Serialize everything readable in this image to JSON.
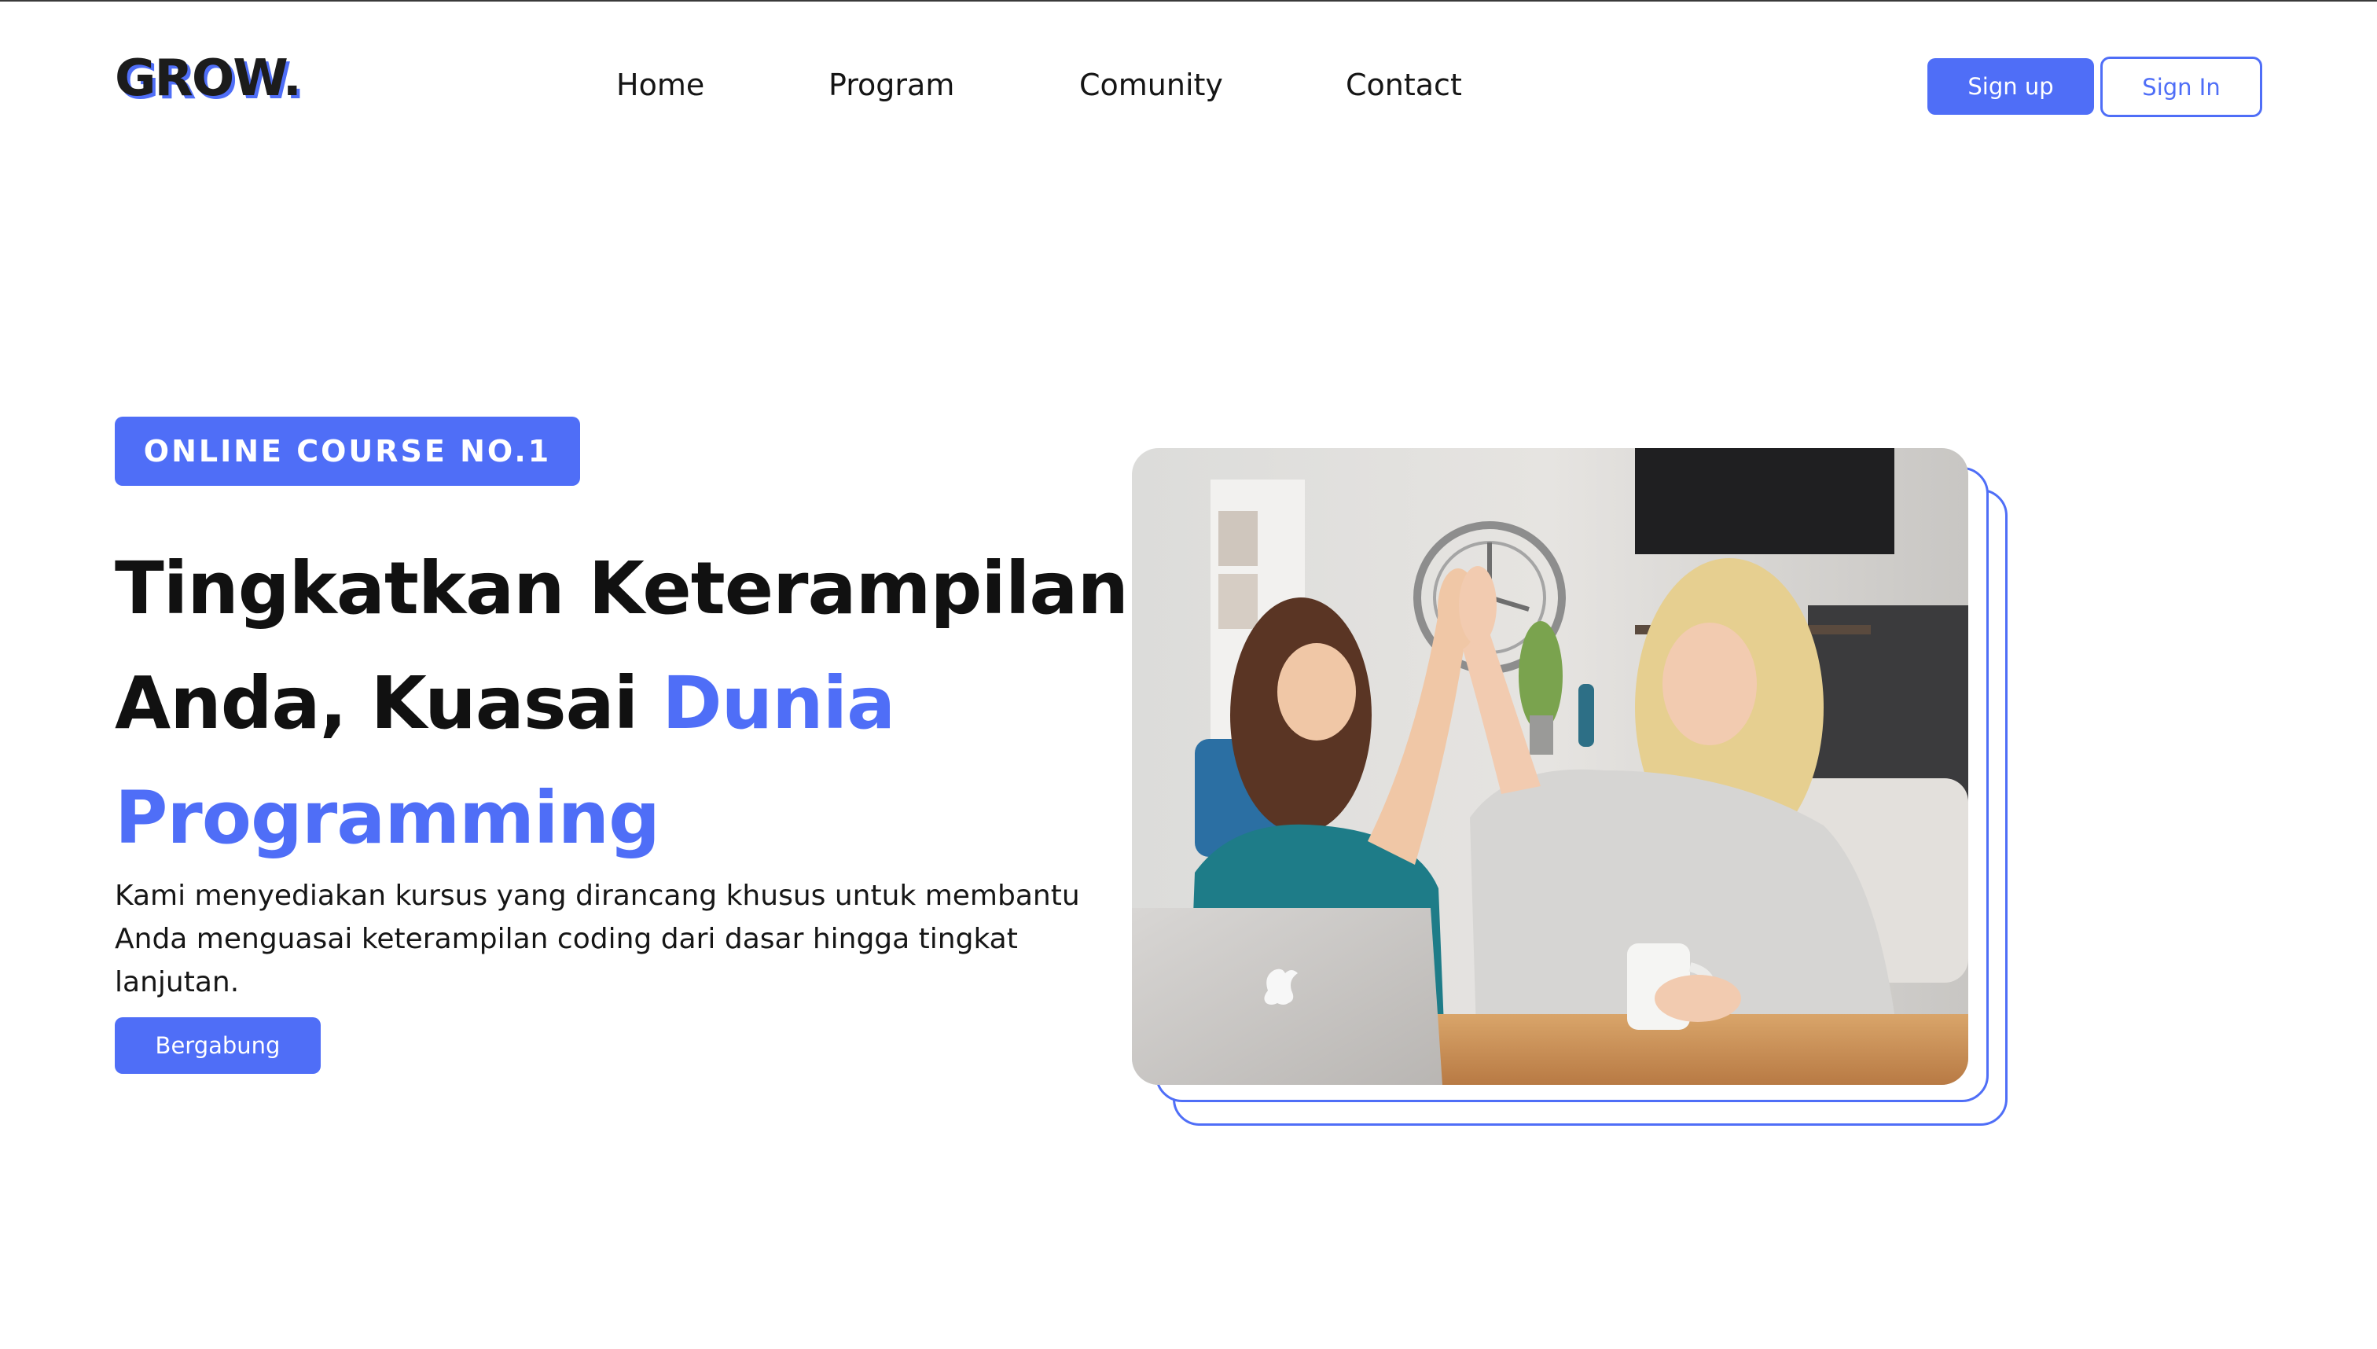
{
  "header": {
    "logo": "GROW.",
    "nav": {
      "home": "Home",
      "program": "Program",
      "community": "Comunity",
      "contact": "Contact"
    },
    "signup_label": "Sign up",
    "signin_label": "Sign In"
  },
  "hero": {
    "badge": "ONLINE COURSE NO.1",
    "headline_line1": "Tingkatkan Keterampilan",
    "headline_line2_start": "Anda, Kuasai ",
    "headline_line2_accent": "Dunia",
    "headline_line3_accent": "Programming",
    "description": "Kami menyediakan kursus yang dirancang khusus untuk membantu Anda menguasai keterampilan coding dari dasar hingga tingkat lanjutan.",
    "cta_label": "Bergabung"
  },
  "colors": {
    "accent": "#4f6ef7",
    "text": "#111111",
    "background": "#ffffff"
  }
}
